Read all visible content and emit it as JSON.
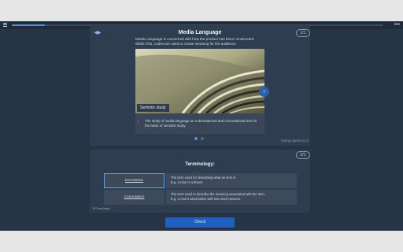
{
  "topbar": {
    "menu_icon": "hamburger-menu-icon",
    "more_icon": "ellipsis-icon",
    "more_label": "•••",
    "progress_fraction": 0.09
  },
  "lesson": {
    "collapse_label": "◀▶",
    "counter": "1/1",
    "title": "Media Language",
    "intro_lines": [
      "Media Language is concerned with how the product has been constructed.",
      "Within this, codes are used to create meaning for the audience."
    ],
    "image_caption": "Semiotic study",
    "next_label": "›",
    "bullets": [
      "The study of media language on a denotational and connotational level is the basis of semiotic study."
    ],
    "typing_speed": "Typing speed x1.0"
  },
  "terminology": {
    "counter": "0/1",
    "heading": "Terminology:",
    "terms": [
      {
        "label": "Denotation",
        "definition": [
          "The term used for describing what an item is",
          "E.g. a rose is a flower."
        ]
      },
      {
        "label": "Connotation",
        "definition": [
          "The term used to describe the meaning associated with the item.",
          "E.g. a rose's association with love and romance."
        ]
      }
    ],
    "feedback": "✉ Feedback"
  },
  "actions": {
    "check_label": "Check"
  },
  "colors": {
    "background": "#263446",
    "card": "#2f3d50",
    "accent": "#1f5fbf"
  }
}
